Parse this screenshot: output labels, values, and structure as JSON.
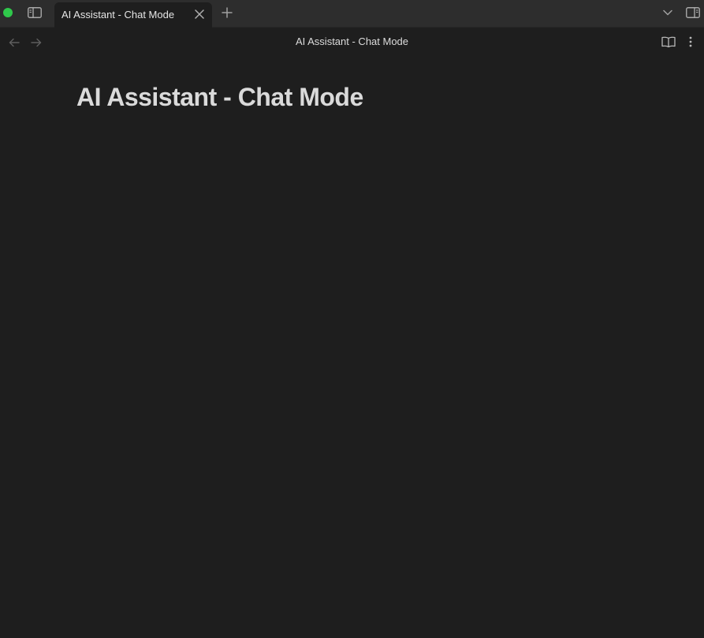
{
  "window": {
    "traffic_light_color": "#2fc84b"
  },
  "tabs": [
    {
      "label": "AI Assistant - Chat Mode",
      "active": true
    }
  ],
  "icons": {
    "sidebar_toggle": "sidebar-left-icon",
    "tab_close": "close-icon",
    "new_tab": "plus-icon",
    "tab_list": "chevron-down-icon",
    "right_sidebar_toggle": "sidebar-right-icon",
    "back": "arrow-left-icon",
    "forward": "arrow-right-icon",
    "reading_view": "book-open-icon",
    "more_options": "more-vertical-icon"
  },
  "navbar": {
    "title": "AI Assistant - Chat Mode"
  },
  "document": {
    "title": "AI Assistant - Chat Mode"
  },
  "colors": {
    "background": "#1e1e1e",
    "titlebar": "#2d2d2d",
    "text": "#dadada"
  }
}
